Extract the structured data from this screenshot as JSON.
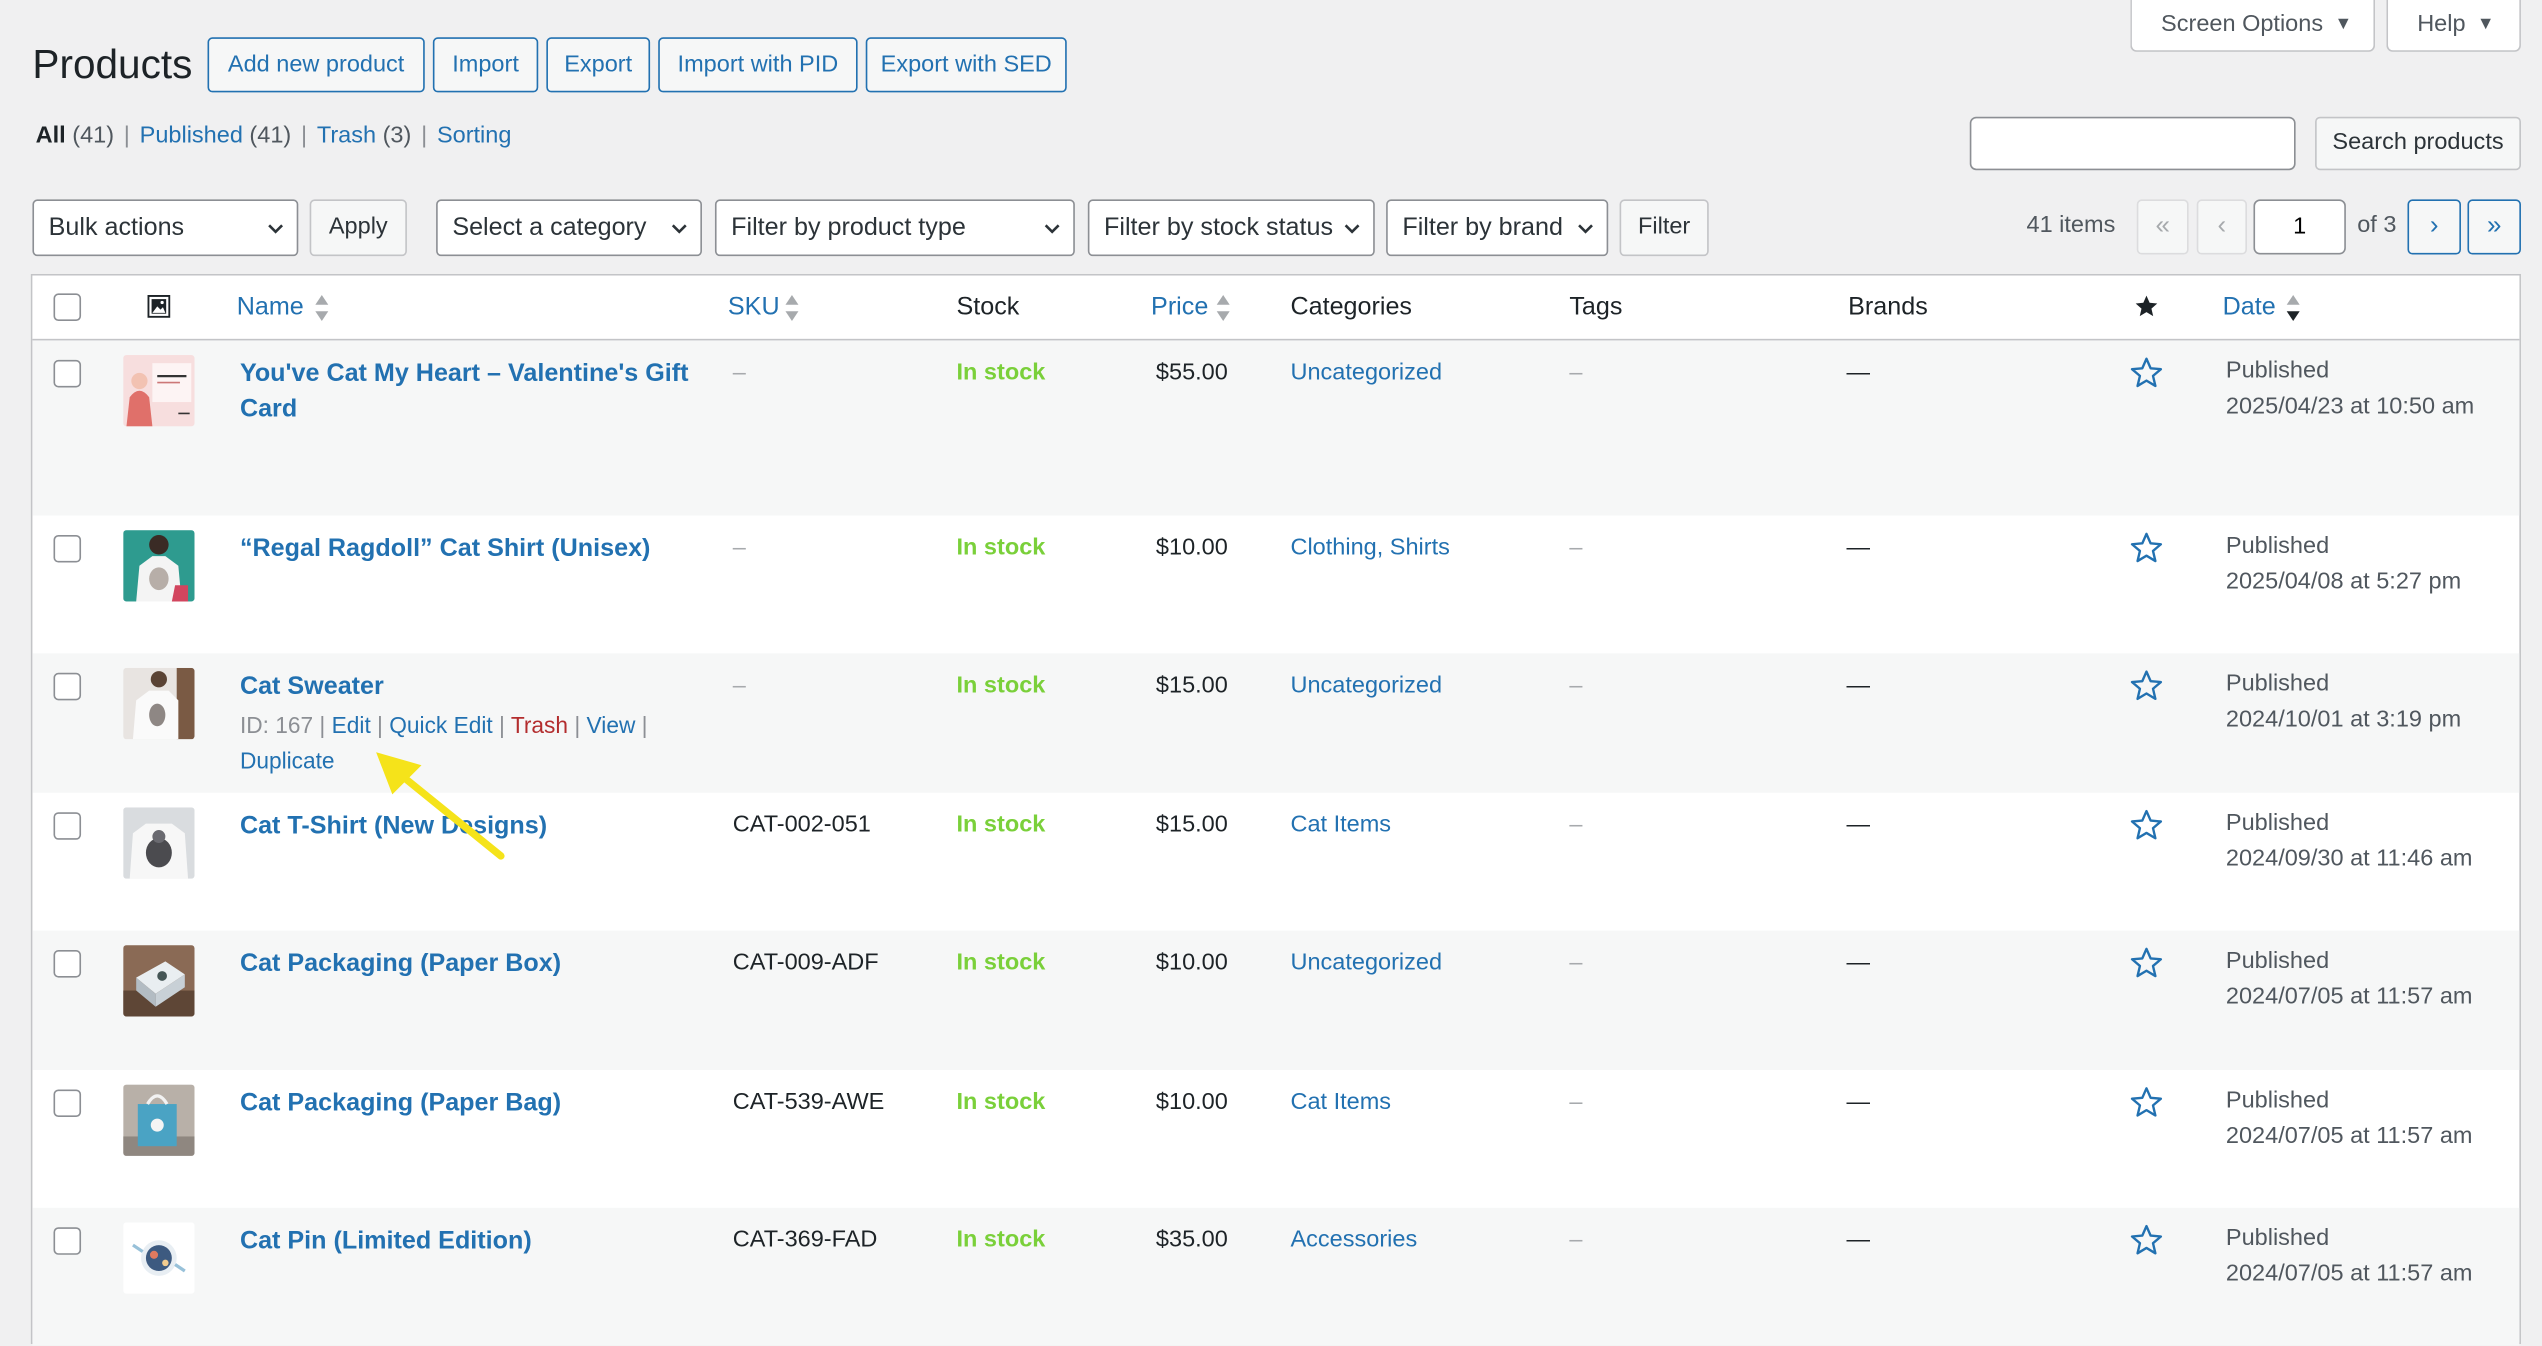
{
  "page": {
    "title": "Products"
  },
  "header_buttons": {
    "add_new": "Add new product",
    "import": "Import",
    "export": "Export",
    "import_pid": "Import with PID",
    "export_sed": "Export with SED"
  },
  "screen_tabs": {
    "screen_options": "Screen Options",
    "help": "Help"
  },
  "views": {
    "all": "All",
    "all_count": "(41)",
    "published": "Published",
    "published_count": "(41)",
    "trash": "Trash",
    "trash_count": "(3)",
    "sorting": "Sorting",
    "separator": "|"
  },
  "search": {
    "value": "",
    "placeholder": "",
    "button": "Search products"
  },
  "filters": {
    "bulk_actions": "Bulk actions",
    "apply": "Apply",
    "category": "Select a category",
    "product_type": "Filter by product type",
    "stock_status": "Filter by stock status",
    "brand": "Filter by brand",
    "filter": "Filter"
  },
  "pagination": {
    "items": "41 items",
    "first": "«",
    "prev": "‹",
    "next": "›",
    "last": "»",
    "current_page": "1",
    "of_label": "of 3"
  },
  "columns": {
    "name": "Name",
    "sku": "SKU",
    "stock": "Stock",
    "price": "Price",
    "categories": "Categories",
    "tags": "Tags",
    "brands": "Brands",
    "date": "Date"
  },
  "row_actions": {
    "id": "ID: 167",
    "edit": "Edit",
    "quick_edit": "Quick Edit",
    "trash": "Trash",
    "view": "View",
    "duplicate": "Duplicate",
    "separator": "|"
  },
  "products": [
    {
      "name": "You've Cat My Heart – Valentine's Gift Card",
      "sku": "–",
      "stock": "In stock",
      "price": "$55.00",
      "categories": "Uncategorized",
      "tags": "–",
      "brands": "—",
      "status": "Published",
      "date": "2025/04/23 at 10:50 am"
    },
    {
      "name": "“Regal Ragdoll” Cat Shirt (Unisex)",
      "sku": "–",
      "stock": "In stock",
      "price": "$10.00",
      "categories": "Clothing, Shirts",
      "tags": "–",
      "brands": "—",
      "status": "Published",
      "date": "2025/04/08 at 5:27 pm"
    },
    {
      "name": "Cat Sweater",
      "sku": "–",
      "stock": "In stock",
      "price": "$15.00",
      "categories": "Uncategorized",
      "tags": "–",
      "brands": "—",
      "status": "Published",
      "date": "2024/10/01 at 3:19 pm"
    },
    {
      "name": "Cat T-Shirt (New Designs)",
      "sku": "CAT-002-051",
      "stock": "In stock",
      "price": "$15.00",
      "categories": "Cat Items",
      "tags": "–",
      "brands": "—",
      "status": "Published",
      "date": "2024/09/30 at 11:46 am"
    },
    {
      "name": "Cat Packaging (Paper Box)",
      "sku": "CAT-009-ADF",
      "stock": "In stock",
      "price": "$10.00",
      "categories": "Uncategorized",
      "tags": "–",
      "brands": "—",
      "status": "Published",
      "date": "2024/07/05 at 11:57 am"
    },
    {
      "name": "Cat Packaging (Paper Bag)",
      "sku": "CAT-539-AWE",
      "stock": "In stock",
      "price": "$10.00",
      "categories": "Cat Items",
      "tags": "–",
      "brands": "—",
      "status": "Published",
      "date": "2024/07/05 at 11:57 am"
    },
    {
      "name": "Cat Pin (Limited Edition)",
      "sku": "CAT-369-FAD",
      "stock": "In stock",
      "price": "$35.00",
      "categories": "Accessories",
      "tags": "–",
      "brands": "—",
      "status": "Published",
      "date": "2024/07/05 at 11:57 am"
    }
  ],
  "colors": {
    "accent": "#2271b1",
    "in_stock": "#7ad03a",
    "trash": "#b32d2e",
    "annotation_arrow": "#f5e31a"
  }
}
